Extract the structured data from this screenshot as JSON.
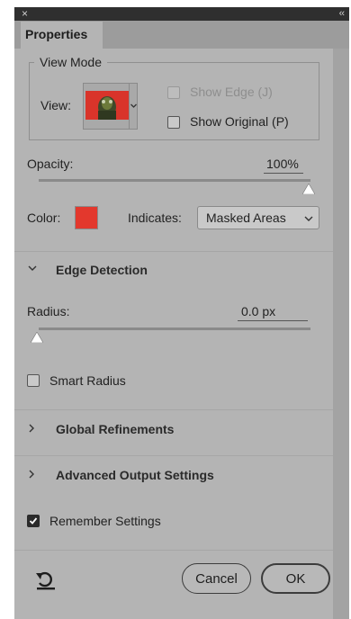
{
  "window": {
    "close_glyph": "×",
    "collapse_glyph": "‹‹"
  },
  "tab": {
    "label": "Properties"
  },
  "view_mode": {
    "legend": "View Mode",
    "view_label": "View:",
    "thumbnail_icon": "photo-preview-thumbnail",
    "show_edge": {
      "label": "Show Edge (J)",
      "checked": false,
      "disabled": true
    },
    "show_original": {
      "label": "Show Original (P)",
      "checked": false
    }
  },
  "opacity": {
    "label": "Opacity:",
    "value": "100%",
    "level": 1.0
  },
  "color": {
    "label": "Color:",
    "swatch": "#e3382d"
  },
  "indicates": {
    "label": "Indicates:",
    "selected": "Masked Areas"
  },
  "edge_detection": {
    "title": "Edge Detection",
    "expanded": true,
    "radius": {
      "label": "Radius:",
      "value": "0.0 px",
      "level": 0.0
    },
    "smart_radius": {
      "label": "Smart Radius",
      "checked": false
    }
  },
  "global_refinements": {
    "title": "Global Refinements",
    "expanded": false
  },
  "advanced_output": {
    "title": "Advanced Output Settings",
    "expanded": false
  },
  "remember": {
    "label": "Remember Settings",
    "checked": true
  },
  "footer": {
    "reset_icon": "reset-arrow-icon",
    "cancel_label": "Cancel",
    "ok_label": "OK"
  }
}
